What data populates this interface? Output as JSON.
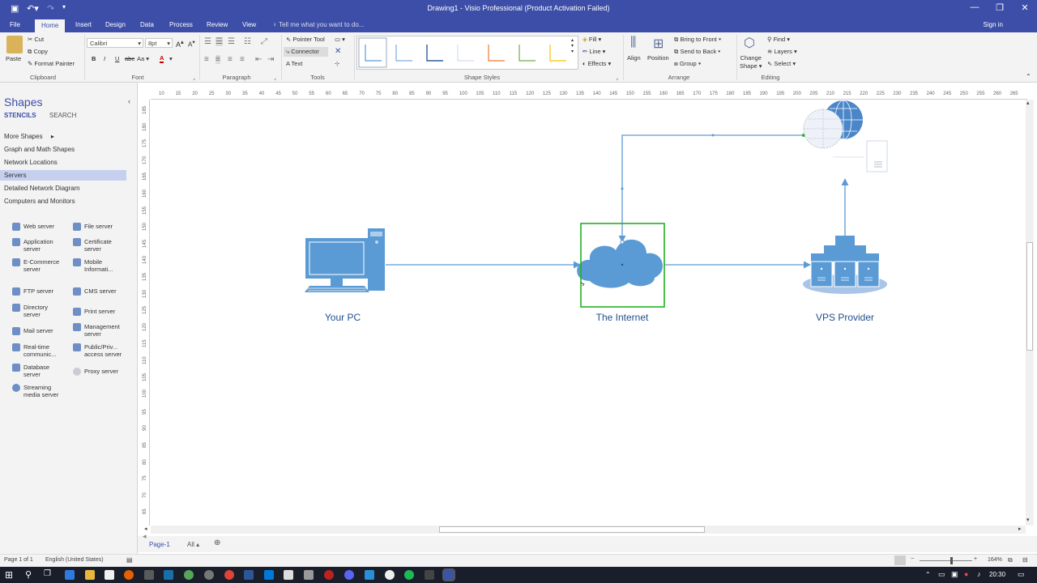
{
  "window": {
    "title": "Drawing1 - Visio Professional (Product Activation Failed)"
  },
  "tabs": [
    "File",
    "Home",
    "Insert",
    "Design",
    "Data",
    "Process",
    "Review",
    "View"
  ],
  "tell_me": "Tell me what you want to do...",
  "sign_in": "Sign in",
  "ribbon": {
    "clipboard": {
      "paste": "Paste",
      "cut": "Cut",
      "copy": "Copy",
      "format_painter": "Format Painter",
      "label": "Clipboard"
    },
    "font": {
      "name": "Calibri",
      "size": "8pt",
      "label": "Font"
    },
    "paragraph": {
      "label": "Paragraph"
    },
    "tools": {
      "pointer": "Pointer Tool",
      "connector": "Connector",
      "text": "Text",
      "label": "Tools"
    },
    "shape_styles": {
      "label": "Shape Styles",
      "fill": "Fill",
      "line": "Line",
      "effects": "Effects"
    },
    "arrange": {
      "align": "Align",
      "position": "Position",
      "bring_front": "Bring to Front",
      "send_back": "Send to Back",
      "group": "Group",
      "label": "Arrange"
    },
    "editing": {
      "change_shape_1": "Change",
      "change_shape_2": "Shape",
      "find": "Find",
      "layers": "Layers",
      "select": "Select",
      "label": "Editing"
    }
  },
  "shapes_pane": {
    "title": "Shapes",
    "tab_stencils": "STENCILS",
    "tab_search": "SEARCH",
    "stencils": [
      "More Shapes",
      "Graph and Math Shapes",
      "Network Locations",
      "Servers",
      "Detailed Network Diagram",
      "Computers and Monitors"
    ],
    "items": [
      {
        "l1": "Web server",
        "l2": ""
      },
      {
        "l1": "File server",
        "l2": ""
      },
      {
        "l1": "Application",
        "l2": "server"
      },
      {
        "l1": "Certificate",
        "l2": "server"
      },
      {
        "l1": "E-Commerce",
        "l2": "server"
      },
      {
        "l1": "Mobile",
        "l2": "Informati..."
      },
      {
        "l1": "FTP server",
        "l2": ""
      },
      {
        "l1": "CMS server",
        "l2": ""
      },
      {
        "l1": "Directory",
        "l2": "server"
      },
      {
        "l1": "Print server",
        "l2": ""
      },
      {
        "l1": "Mail server",
        "l2": ""
      },
      {
        "l1": "Management",
        "l2": "server"
      },
      {
        "l1": "Real-time",
        "l2": "communic..."
      },
      {
        "l1": "Public/Priv...",
        "l2": "access server"
      },
      {
        "l1": "Database",
        "l2": "server"
      },
      {
        "l1": "Proxy server",
        "l2": ""
      },
      {
        "l1": "Streaming",
        "l2": "media server"
      }
    ]
  },
  "ruler_h": [
    "10",
    "15",
    "20",
    "25",
    "30",
    "35",
    "40",
    "45",
    "50",
    "55",
    "60",
    "65",
    "70",
    "75",
    "80",
    "85",
    "90",
    "95",
    "100",
    "105",
    "110",
    "115",
    "120",
    "125",
    "130",
    "135",
    "140",
    "145",
    "150",
    "155",
    "160",
    "165",
    "170",
    "175",
    "180",
    "185",
    "190",
    "195",
    "200",
    "205",
    "210",
    "215",
    "220",
    "225",
    "230",
    "235",
    "240",
    "245",
    "250",
    "255",
    "260",
    "265"
  ],
  "ruler_v": [
    "185",
    "180",
    "175",
    "170",
    "165",
    "160",
    "155",
    "150",
    "145",
    "140",
    "135",
    "130",
    "125",
    "120",
    "115",
    "110",
    "105",
    "100",
    "95",
    "90",
    "85",
    "80",
    "75",
    "70",
    "65"
  ],
  "diagram": {
    "pc_label": "Your PC",
    "internet_label": "The Internet",
    "vps_label": "VPS Provider"
  },
  "page_tabs": {
    "page": "Page-1",
    "all": "All"
  },
  "status": {
    "page": "Page 1 of 1",
    "lang": "English (United States)",
    "zoom": "164%"
  },
  "clock": "20:30",
  "colors": {
    "accent": "#3c4ea8",
    "shape": "#5b9bd5",
    "selection": "#22b022"
  }
}
